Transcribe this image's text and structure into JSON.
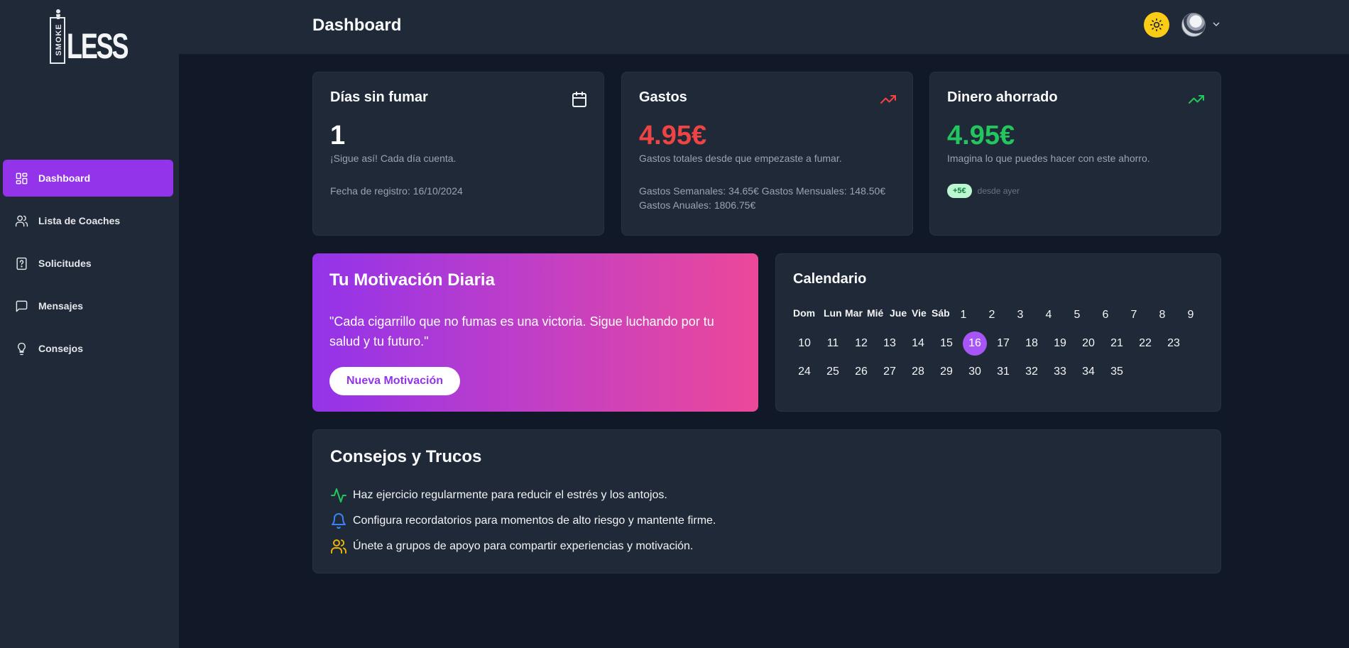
{
  "app": {
    "logo_word": "LESS",
    "logo_side_text": "SMOKE"
  },
  "sidebar": {
    "items": [
      {
        "label": "Dashboard",
        "icon": "dashboard-icon",
        "active": true
      },
      {
        "label": "Lista de Coaches",
        "icon": "users-icon"
      },
      {
        "label": "Solicitudes",
        "icon": "question-file-icon"
      },
      {
        "label": "Mensajes",
        "icon": "message-icon"
      },
      {
        "label": "Consejos",
        "icon": "lightbulb-icon"
      }
    ]
  },
  "header": {
    "title": "Dashboard",
    "theme_toggle_icon": "sun-icon",
    "theme_toggle_color": "#facc15"
  },
  "stats": {
    "days": {
      "title": "Días sin fumar",
      "icon": "calendar-icon",
      "value": "1",
      "subtitle": "¡Sigue así! Cada día cuenta.",
      "footer": "Fecha de registro: 16/10/2024"
    },
    "expenses": {
      "title": "Gastos",
      "icon": "trending-up-icon",
      "icon_color": "#ef4444",
      "value": "4.95€",
      "value_color": "#ef4444",
      "subtitle": "Gastos totales desde que empezaste a fumar.",
      "footer_line1": "Gastos Semanales: 34.65€ Gastos Mensuales: 148.50€",
      "footer_line2": "Gastos Anuales: 1806.75€"
    },
    "saved": {
      "title": "Dinero ahorrado",
      "icon": "trending-up-icon",
      "icon_color": "#22c55e",
      "value": "4.95€",
      "value_color": "#22c55e",
      "subtitle": "Imagina lo que puedes hacer con este ahorro.",
      "badge": "+5€",
      "badge_note": "desde ayer"
    }
  },
  "motivation": {
    "title": "Tu Motivación Diaria",
    "quote": "\"Cada cigarrillo que no fumas es una victoria. Sigue luchando por tu salud y tu futuro.\"",
    "button": "Nueva Motivación"
  },
  "calendar": {
    "title": "Calendario",
    "weekdays": [
      "Dom",
      "Lun",
      "Mar",
      "Mié",
      "Jue",
      "Vie",
      "Sáb"
    ],
    "days": [
      "1",
      "2",
      "3",
      "4",
      "5",
      "6",
      "7",
      "8",
      "9",
      "10",
      "11",
      "12",
      "13",
      "14",
      "15",
      "16",
      "17",
      "18",
      "19",
      "20",
      "21",
      "22",
      "23",
      "24",
      "25",
      "26",
      "27",
      "28",
      "29",
      "30",
      "31",
      "32",
      "33",
      "34",
      "35"
    ],
    "today": "16",
    "accent": "#a855f7"
  },
  "tips": {
    "title": "Consejos y Trucos",
    "items": [
      {
        "text": "Haz ejercicio regularmente para reducir el estrés y los antojos.",
        "icon": "activity-icon",
        "color": "#22c55e"
      },
      {
        "text": "Configura recordatorios para momentos de alto riesgo y mantente firme.",
        "icon": "bell-icon",
        "color": "#3b82f6"
      },
      {
        "text": "Únete a grupos de apoyo para compartir experiencias y motivación.",
        "icon": "users-icon",
        "color": "#eab308"
      }
    ]
  }
}
